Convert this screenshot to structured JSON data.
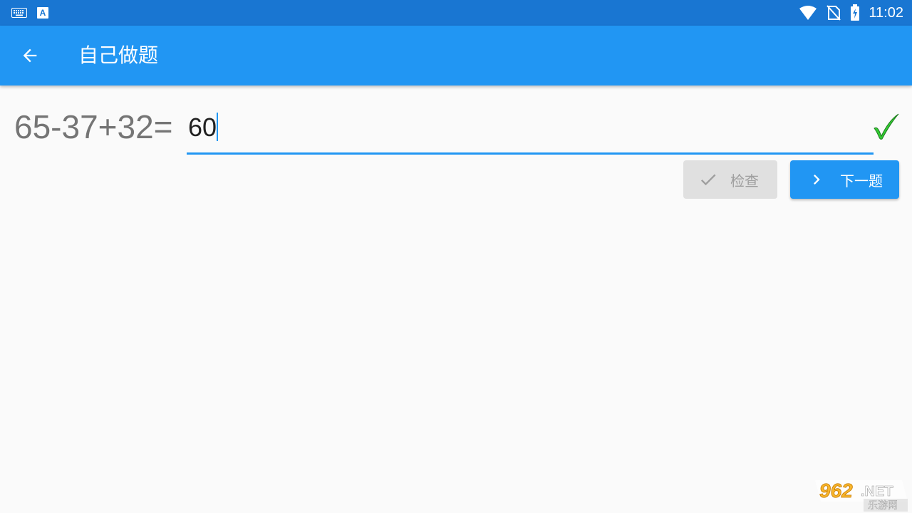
{
  "status_bar": {
    "time": "11:02",
    "left_icons": [
      "keyboard-icon",
      "a-icon"
    ],
    "right_icons": [
      "wifi-icon",
      "no-sim-icon",
      "battery-charging-icon"
    ]
  },
  "app_bar": {
    "title": "自己做题",
    "back_icon": "arrow-back-icon"
  },
  "exercise": {
    "question": "65-37+32=",
    "answer_value": "60",
    "result_icon": "checkmark-icon",
    "result_color": "#33cc33"
  },
  "buttons": {
    "check_label": "检查",
    "check_icon": "checkmark-icon",
    "next_label": "下一题",
    "next_icon": "chevron-right-icon"
  },
  "watermark": {
    "line1": "962.NET",
    "line2": "乐游网"
  },
  "colors": {
    "status_bar": "#1976d2",
    "primary": "#2196f3",
    "background": "#fafafa"
  }
}
